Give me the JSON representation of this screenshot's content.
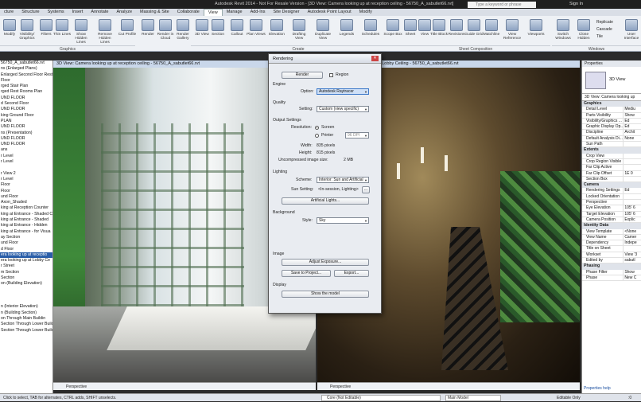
{
  "titlebar": {
    "title": "Autodesk Revit 2014 - Not For Resale Version - [3D View: Camera looking up at reception ceiling - 56750_A_sabutlet66.rvt]",
    "search_placeholder": "Type a keyword or phrase",
    "signin": "Sign In"
  },
  "tabs": [
    "cture",
    "Structure",
    "Systems",
    "Insert",
    "Annotate",
    "Analyze",
    "Massing & Site",
    "Collaborate",
    "View",
    "Manage",
    "Add-Ins",
    "Site Designer",
    "Autodesk Point Layout",
    "Modify"
  ],
  "ribbon": {
    "buttons": [
      {
        "label": "Modify"
      },
      {
        "label": "Visibility/ Graphics"
      },
      {
        "label": "Filters"
      },
      {
        "label": "Thin Lines"
      },
      {
        "label": "Show Hidden Lines"
      },
      {
        "label": "Remove Hidden Lines"
      },
      {
        "label": "Cut Profile"
      },
      {
        "label": "Render"
      },
      {
        "label": "Render in Cloud"
      },
      {
        "label": "Render Gallery"
      },
      {
        "label": "3D View"
      },
      {
        "label": "Section"
      },
      {
        "label": "Callout"
      },
      {
        "label": "Plan Views"
      },
      {
        "label": "Elevation"
      },
      {
        "label": "Drafting View"
      },
      {
        "label": "Duplicate View"
      },
      {
        "label": "Legends"
      },
      {
        "label": "Schedules"
      },
      {
        "label": "Scope Box"
      },
      {
        "label": "Sheet"
      },
      {
        "label": "View"
      },
      {
        "label": "Title Block"
      },
      {
        "label": "Revisions"
      },
      {
        "label": "Guide Grid"
      },
      {
        "label": "Matchline"
      },
      {
        "label": "View Reference"
      },
      {
        "label": "Viewports"
      },
      {
        "label": "Switch Windows"
      },
      {
        "label": "Close Hidden"
      },
      {
        "label": "Replicate"
      },
      {
        "label": "Cascade"
      },
      {
        "label": "Tile"
      },
      {
        "label": "User Interface"
      }
    ],
    "groups": {
      "graphics": "Graphics",
      "create": "Create",
      "sheet": "Sheet Composition",
      "windows": "Windows"
    }
  },
  "project_browser": {
    "header": "",
    "items": [
      {
        "label": "56750_A_sabutlet66.rvt"
      },
      {
        "label": "ns (Enlarged Plans)"
      },
      {
        "label": "Enlarged Second Floor Restroo"
      },
      {
        "label": "Floor"
      },
      {
        "label": "rged Stair Plan"
      },
      {
        "label": "rged Rest Rooms Plan"
      },
      {
        "label": "UND FLOOR"
      },
      {
        "label": "d Second Floor"
      },
      {
        "label": "UND FLOOR"
      },
      {
        "label": "king Ground Floor"
      },
      {
        "label": "PLAN"
      },
      {
        "label": "UND FLOOR"
      },
      {
        "label": "ns (Presentation)"
      },
      {
        "label": "UND FLOOR"
      },
      {
        "label": "UND FLOOR"
      },
      {
        "label": "ans"
      },
      {
        "label": "r Level"
      },
      {
        "label": "r Level"
      },
      {
        "label": ""
      },
      {
        "label": "r View 2"
      },
      {
        "label": "r Level"
      },
      {
        "label": "Floor"
      },
      {
        "label": "Floor"
      },
      {
        "label": "und Floor"
      },
      {
        "label": "Axon_Shaded"
      },
      {
        "label": "king at Reception Counter"
      },
      {
        "label": "king at Entrance - Shaded C"
      },
      {
        "label": "king at Entrance - Shaded"
      },
      {
        "label": "king at Entrance - Hidden"
      },
      {
        "label": "king at Entrance - for Visua"
      },
      {
        "label": "ay Section"
      },
      {
        "label": "und Floor"
      },
      {
        "label": "d Floor"
      },
      {
        "label": "era looking up at receptio",
        "selected": true
      },
      {
        "label": "era looking up at Lobby Ce"
      },
      {
        "label": "r Street"
      },
      {
        "label": "m Section"
      },
      {
        "label": "Section"
      },
      {
        "label": "on (Building Elevation)"
      },
      {
        "label": ""
      },
      {
        "label": ""
      },
      {
        "label": ""
      },
      {
        "label": "n (Interior Elevation)"
      },
      {
        "label": "n (Building Section)"
      },
      {
        "label": "on Through Main Buildin"
      },
      {
        "label": "Section Through Lower Building"
      },
      {
        "label": "Section Through Lower Building"
      }
    ]
  },
  "views": {
    "left_title": "3D View: Camera looking up at reception ceiling - 56750_A_sabutlet66.rvt",
    "right_title": "3D View: Camera looking up at Lobby Ceiling - 56750_A_sabutlet66.rvt",
    "left_mode": "Perspective",
    "right_mode": "Perspective"
  },
  "dialog": {
    "title": "Rendering",
    "render_button": "Render",
    "region_label": "Region",
    "engine_heading": "Engine",
    "option_label": "Option:",
    "option_value": "Autodesk Raytracer",
    "quality_heading": "Quality",
    "setting_label": "Setting:",
    "setting_value": "Custom (view specific)",
    "output_heading": "Output Settings",
    "resolution_label": "Resolution:",
    "screen_label": "Screen",
    "printer_label": "Printer",
    "printer_dpi": "96 DPI",
    "width_label": "Width:",
    "width_value": "835 pixels",
    "height_label": "Height:",
    "height_value": "815 pixels",
    "uncompressed_label": "Uncompressed image size:",
    "uncompressed_value": "2 MB",
    "lighting_heading": "Lighting",
    "scheme_label": "Scheme:",
    "scheme_value": "Interior: Sun and Artificial",
    "sun_label": "Sun Setting:",
    "sun_value": "<In-session, Lighting>",
    "sun_more": "...",
    "artificial_button": "Artificial Lights...",
    "background_heading": "Background",
    "style_label": "Style:",
    "style_value": "Sky",
    "image_heading": "Image",
    "adjust_button": "Adjust Exposure...",
    "save_button": "Save to Project...",
    "export_button": "Export...",
    "display_heading": "Display",
    "show_button": "Show the model"
  },
  "properties": {
    "header": "Properties",
    "type_name": "3D View",
    "selector": "3D View: Camera looking up",
    "sections": [
      {
        "title": "Graphics",
        "rows": [
          [
            "Detail Level",
            "Mediu"
          ],
          [
            "Parts Visibility",
            "Show"
          ],
          [
            "Visibility/Graphics ...",
            "Ed"
          ],
          [
            "Graphic Display Op...",
            "Ed"
          ],
          [
            "Discipline",
            "Archit"
          ],
          [
            "Default Analysis Di...",
            "None"
          ],
          [
            "Sun Path",
            ""
          ]
        ]
      },
      {
        "title": "Extents",
        "rows": [
          [
            "Crop View",
            ""
          ],
          [
            "Crop Region Visible",
            ""
          ],
          [
            "Far Clip Active",
            ""
          ],
          [
            "Far Clip Offset",
            "1E 0"
          ],
          [
            "Section Box",
            ""
          ]
        ]
      },
      {
        "title": "Camera",
        "rows": [
          [
            "Rendering Settings",
            "Ed"
          ],
          [
            "Locked Orientation",
            ""
          ],
          [
            "Perspective",
            ""
          ],
          [
            "Eye Elevation",
            "105' 6"
          ],
          [
            "Target Elevation",
            "105' 6"
          ],
          [
            "Camera Position",
            "Explic"
          ]
        ]
      },
      {
        "title": "Identity Data",
        "rows": [
          [
            "View Template",
            "<None"
          ],
          [
            "View Name",
            "Camer"
          ],
          [
            "Dependency",
            "Indepe"
          ],
          [
            "Title on Sheet",
            ""
          ],
          [
            "Workset",
            "View '3"
          ],
          [
            "Edited by",
            "sabutl"
          ]
        ]
      },
      {
        "title": "Phasing",
        "rows": [
          [
            "Phase Filter",
            "Show"
          ],
          [
            "Phase",
            "New C"
          ]
        ]
      }
    ],
    "help": "Properties help"
  },
  "statusbar": {
    "left": "Click to select, TAB for alternates, CTRL adds, SHIFT unselects.",
    "workset": "Core (Not Editable)",
    "model": "Main Model",
    "editable": "Editable Only",
    "filter": ":0"
  },
  "colors": {
    "accent": "#2a5ea8",
    "ribbon": "#eef1f5",
    "titlebar": "#1f1f1f",
    "dialog": "#e9ecf1"
  }
}
